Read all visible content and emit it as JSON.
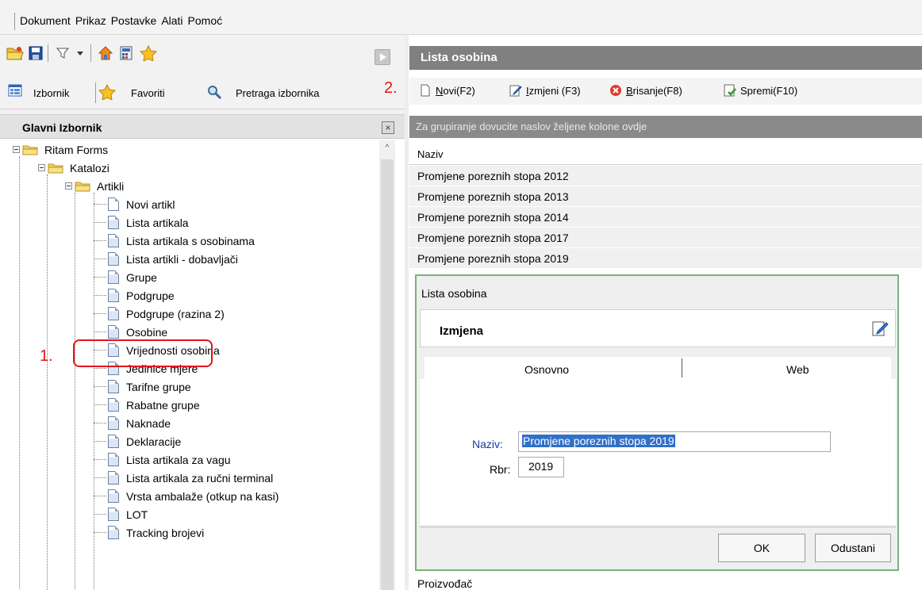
{
  "menubar": {
    "items": [
      "Dokument",
      "Prikaz",
      "Postavke",
      "Alati",
      "Pomoć"
    ]
  },
  "toolbar": {
    "icons": [
      "open-folder-icon",
      "save-icon",
      "filter-icon",
      "dropdown-arrow-icon",
      "home-icon",
      "calculator-icon",
      "star-icon",
      "play-icon"
    ]
  },
  "tabs": {
    "izbornik": "Izbornik",
    "favoriti": "Favoriti",
    "pretraga": "Pretraga izbornika"
  },
  "menupanel": {
    "title": "Glavni Izbornik",
    "close": "×",
    "scroll_up": "^"
  },
  "tree": {
    "root": "Ritam Forms",
    "katalozi": "Katalozi",
    "artikli": "Artikli",
    "items": [
      "Novi artikl",
      "Lista artikala",
      "Lista artikala s osobinama",
      "Lista artikli - dobavljači",
      "Grupe",
      "Podgrupe",
      "Podgrupe (razina 2)",
      "Osobine",
      "Vrijednosti osobina",
      "Jedinice mjere",
      "Tarifne grupe",
      "Rabatne grupe",
      "Naknade",
      "Deklaracije",
      "Lista artikala za vagu",
      "Lista artikala za ručni terminal",
      "Vrsta ambalaže (otkup na kasi)",
      "LOT",
      "Tracking brojevi"
    ]
  },
  "annotations": {
    "one": "1.",
    "two": "2."
  },
  "right": {
    "title": "Lista osobina",
    "toolbar": {
      "novi_pre": "N",
      "novi_post": "ovi(F2)",
      "izmjeni_pre": "I",
      "izmjeni_post": "zmjeni (F3)",
      "brisanje_pre": "B",
      "brisanje_post": "risanje(F8)",
      "spremi": "Spremi(F10)"
    },
    "group_hint": "Za grupiranje dovucite naslov željene kolone ovdje",
    "column": "Naziv",
    "rows": [
      "Promjene poreznih stopa 2012",
      "Promjene poreznih stopa 2013",
      "Promjene poreznih stopa 2014",
      "Promjene poreznih stopa 2017",
      "Promjene poreznih stopa 2019"
    ],
    "bottom_row": "Proizvođač"
  },
  "dialog": {
    "title": "Lista osobina",
    "header": "Izmjena",
    "tabs": [
      "Osnovno",
      "Web"
    ],
    "naziv_label": "Naziv:",
    "naziv_value": "Promjene poreznih stopa 2019",
    "rbr_label": "Rbr:",
    "rbr_value": "2019",
    "ok": "OK",
    "cancel": "Odustani"
  },
  "colors": {
    "accent_red": "#e3151a",
    "header_gray": "#808080",
    "selection_blue": "#3070c8",
    "dialog_border": "#7bb17b"
  }
}
